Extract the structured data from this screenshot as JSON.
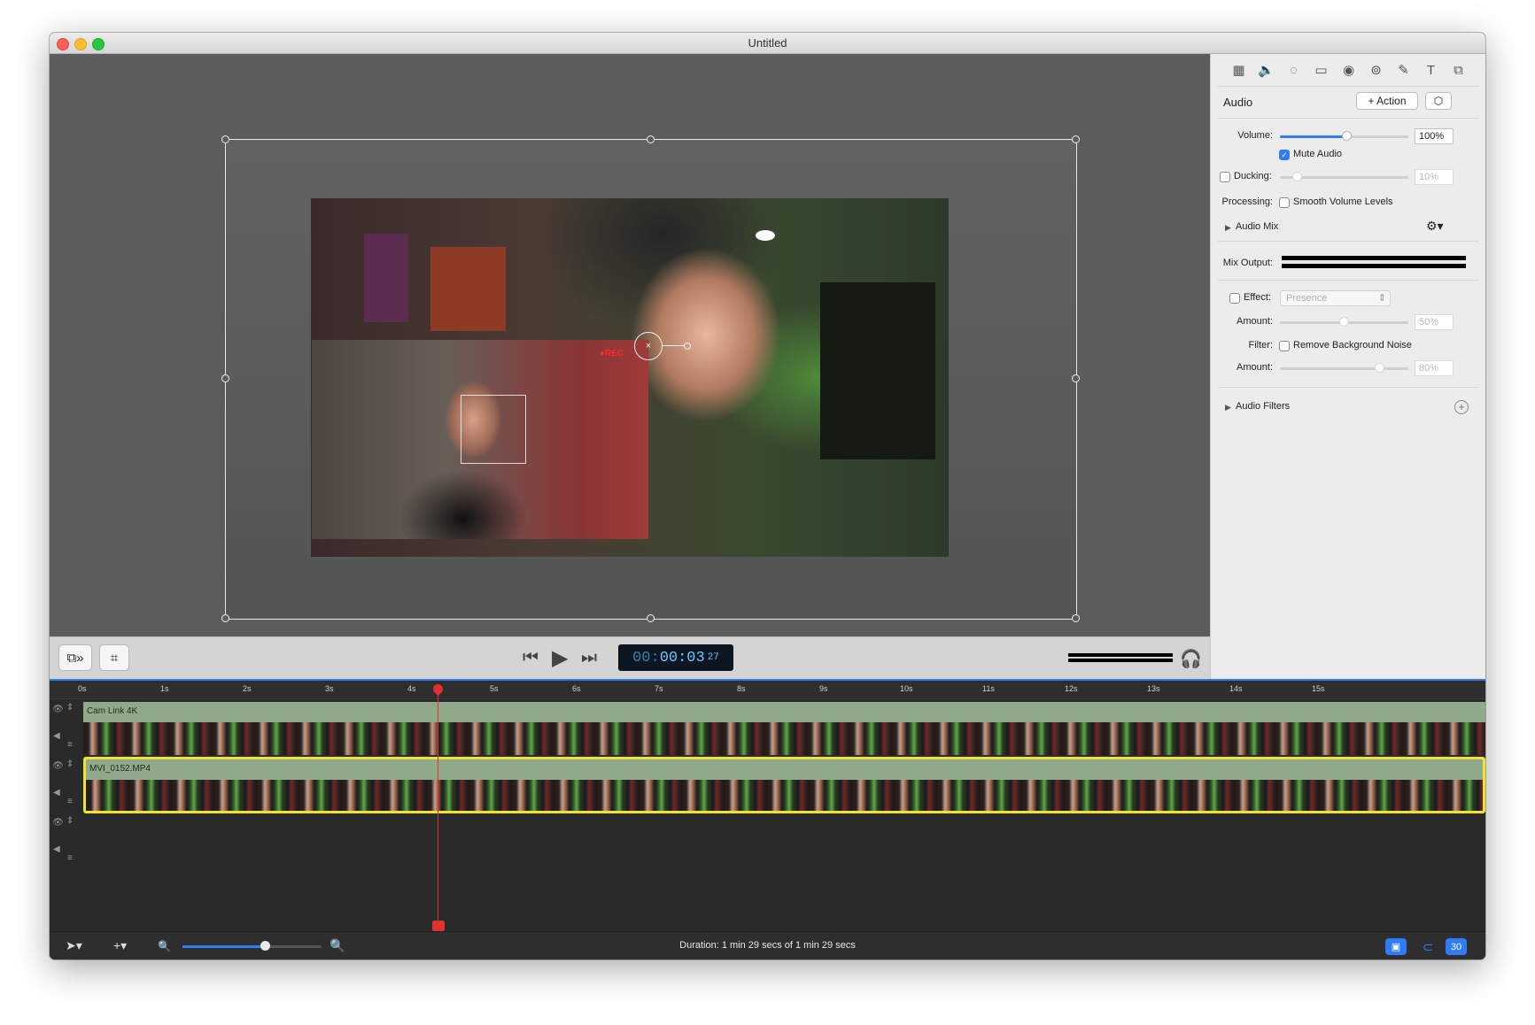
{
  "window": {
    "title": "Untitled"
  },
  "canvas": {
    "pip_overlay_text": "●REC",
    "rotate_handle_glyph": "×"
  },
  "transport": {
    "timecode_dim": "00:",
    "timecode_main": "00:03",
    "timecode_frames": "27"
  },
  "inspector": {
    "section_title": "Audio",
    "action_button": "+ Action",
    "volume_label": "Volume:",
    "volume_value": "100%",
    "volume_level": 0.52,
    "mute_label": "Mute Audio",
    "mute_checked": true,
    "ducking_label": "Ducking:",
    "ducking_value": "10%",
    "processing_label": "Processing:",
    "smooth_label": "Smooth Volume Levels",
    "audio_mix_label": "Audio Mix",
    "mix_output_label": "Mix Output:",
    "effect_label": "Effect:",
    "effect_select": "Presence",
    "amount_label": "Amount:",
    "effect_amount_value": "50%",
    "filter_label": "Filter:",
    "remove_noise_label": "Remove Background Noise",
    "filter_amount_value": "80%",
    "audio_filters_label": "Audio Filters",
    "tabs": [
      "film-icon",
      "speaker-icon",
      "dashed-circle-icon",
      "screen-icon",
      "cursor-circle-icon",
      "circles-icon",
      "pencil-icon",
      "text-icon",
      "stack-icon"
    ]
  },
  "timeline": {
    "ruler": [
      "0s",
      "1s",
      "2s",
      "3s",
      "4s",
      "5s",
      "6s",
      "7s",
      "8s",
      "9s",
      "10s",
      "11s",
      "12s",
      "13s",
      "14s",
      "15s"
    ],
    "tracks": [
      {
        "clip_name": "Cam Link 4K",
        "selected": false
      },
      {
        "clip_name": "MVI_0152.MP4",
        "selected": true
      },
      {
        "clip_name": "",
        "selected": false
      }
    ]
  },
  "statusbar": {
    "duration": "Duration: 1 min 29 secs of 1 min 29 secs",
    "fps_badge": "30"
  },
  "colors": {
    "accent": "#2f7cf6",
    "selection": "#f2e22a",
    "playhead": "#e03030",
    "clip_header": "#8fa98a"
  }
}
